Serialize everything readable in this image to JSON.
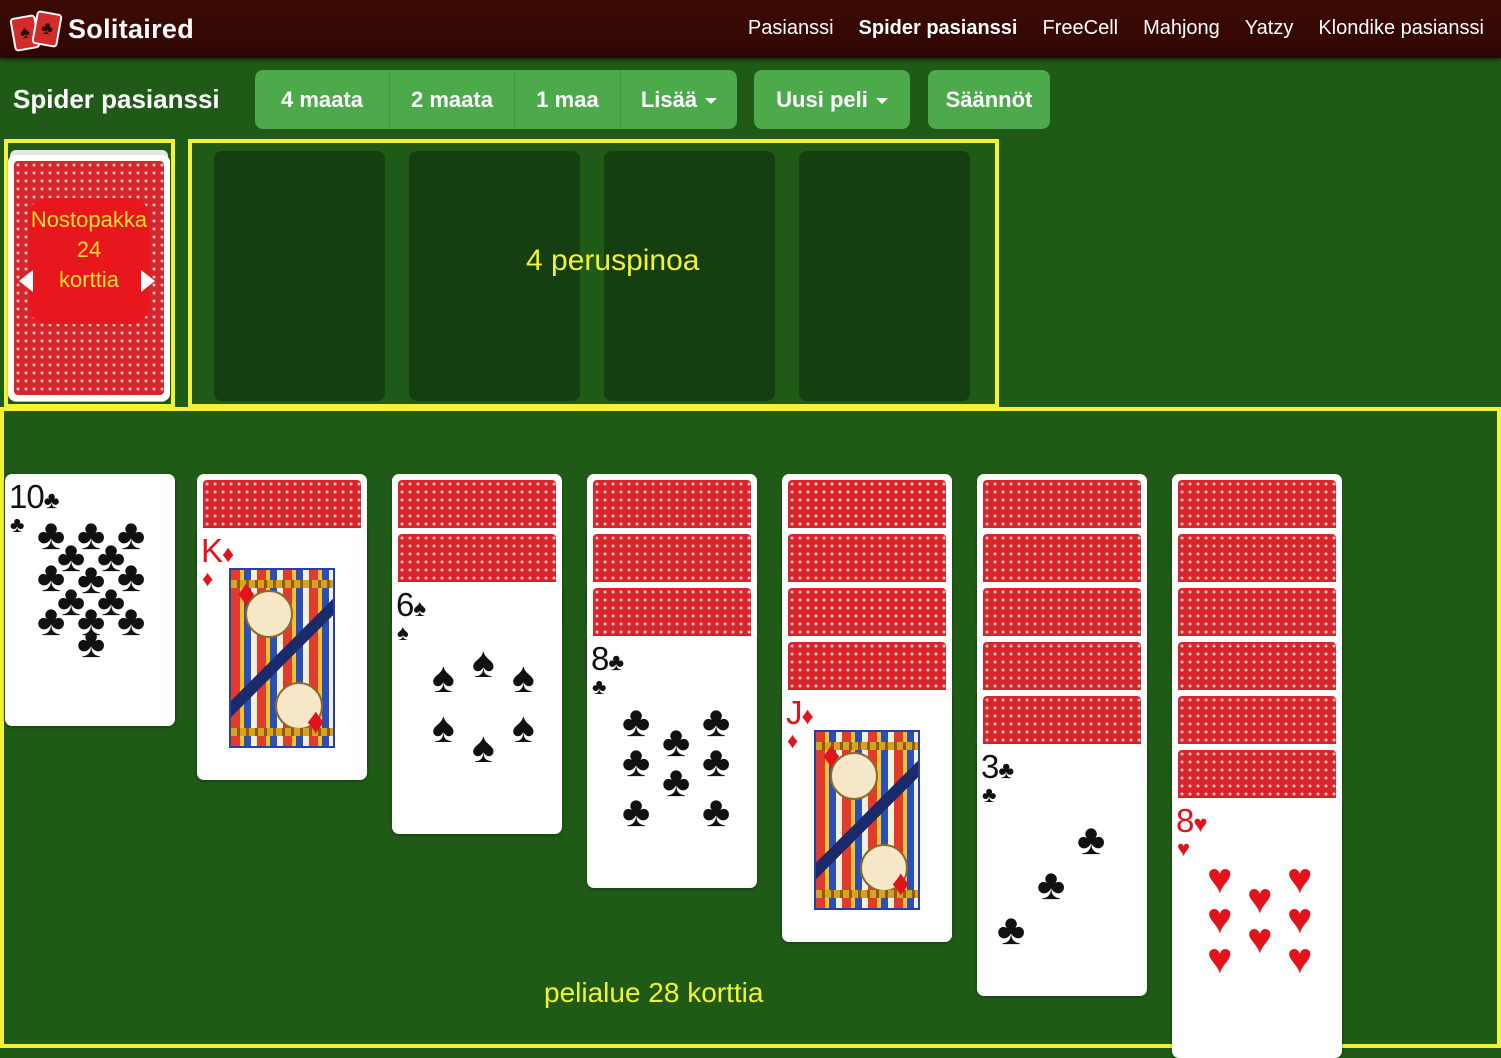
{
  "brand": {
    "name": "Solitaired"
  },
  "nav": [
    "Pasianssi",
    "Spider pasianssi",
    "FreeCell",
    "Mahjong",
    "Yatzy",
    "Klondike pasianssi"
  ],
  "nav_active": "Spider pasianssi",
  "title": "Spider pasianssi",
  "buttons": {
    "suits4": "4 maata",
    "suits2": "2 maata",
    "suits1": "1 maa",
    "more": "Lisää",
    "new_game": "Uusi peli",
    "rules": "Säännöt"
  },
  "stock": {
    "line1": "Nostopakka",
    "line2": "24",
    "line3": "korttia"
  },
  "foundations_label": "4 peruspinoa",
  "tableau_label": "pelialue 28 korttia",
  "colors": {
    "felt": "#1f5a17",
    "accent": "#f4f235",
    "button": "#4caa4a",
    "topbar": "#3e0a06",
    "card_back": "#d8252c"
  },
  "tableau": [
    {
      "face_down": 0,
      "top": {
        "rank": "10",
        "suit": "♣",
        "color": "black"
      }
    },
    {
      "face_down": 1,
      "top": {
        "rank": "K",
        "suit": "♦",
        "color": "red"
      }
    },
    {
      "face_down": 2,
      "top": {
        "rank": "6",
        "suit": "♠",
        "color": "black"
      }
    },
    {
      "face_down": 3,
      "top": {
        "rank": "8",
        "suit": "♣",
        "color": "black"
      }
    },
    {
      "face_down": 4,
      "top": {
        "rank": "J",
        "suit": "♦",
        "color": "red"
      }
    },
    {
      "face_down": 5,
      "top": {
        "rank": "3",
        "suit": "♣",
        "color": "black"
      }
    },
    {
      "face_down": 6,
      "top": {
        "rank": "8",
        "suit": "♥",
        "color": "red"
      }
    }
  ]
}
